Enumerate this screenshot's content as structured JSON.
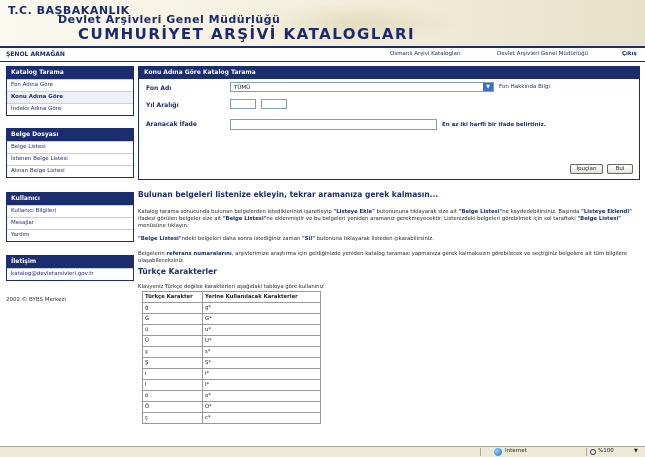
{
  "header": {
    "line1": "T.C. BAŞBAKANLIK",
    "line2": "Devlet Arşivleri Genel Müdürlüğü",
    "line3": "CUMHURİYET ARŞİVİ KATALOGLARI"
  },
  "topnav": {
    "user": "ŞENOL ARMAĞAN",
    "links": [
      "Osmanlı Arşivi Katalogları",
      "Devlet Arşivleri Genel Müdürlüğü",
      "Çıkış"
    ]
  },
  "sidebar": {
    "sections": [
      {
        "title": "Katalog Tarama",
        "items": [
          "Fon Adına Göre",
          "Konu Adına Göre",
          "İndeks Adına Göre"
        ]
      },
      {
        "title": "Belge Dosyası",
        "items": [
          "Belge Listesi",
          "İstenen Belge Listesi",
          "Alınan Belge Listesi"
        ]
      },
      {
        "title": "Kullanıcı",
        "items": [
          "Kullanıcı Bilgileri",
          "Mesajlar",
          "Yardım"
        ]
      },
      {
        "title": "İletişim",
        "items": [
          "katalog@devletarsivleri.gov.tr"
        ]
      }
    ],
    "copyright": "2002 © BYBS Merkezi"
  },
  "form": {
    "title": "Konu Adına Göre Katalog Tarama",
    "fon_label": "Fon Adı",
    "fon_value": "TÜMÜ",
    "fon_info": "Fon Hakkında Bilgi",
    "year_label": "Yıl Aralığı",
    "query_label": "Aranacak İfade",
    "query_hint": "En az iki harfli bir ifade belirtiniz.",
    "hint_button": "İpuçları",
    "find_button": "Bul"
  },
  "content": {
    "title": "Bulunan belgeleri listenize ekleyin, tekrar aramanıza gerek kalmasın...",
    "p1_a": "Katalog tarama sonucunda bulunan belgelerden istediklerinizi işaretleyip ",
    "p1_b": "\"Listeye Ekle\"",
    "p1_c": " butonununa tıklayarak size ait ",
    "p1_d": "\"Belge Listesi\"",
    "p1_e": "ne kaydedebilirsiniz. Başında ",
    "p1_f": "\"Listeye Eklendi\"",
    "p1_g": " ifadesi görülen belgeler size ait ",
    "p1_h": "\"Belge Listesi\"",
    "p1_i": "ne eklenmiştir ve bu belgeleri yeniden aramanız gerekmeyecektir. Listenizdeki belgeleri görebilmek için sol taraftaki ",
    "p1_j": "\"Belge Listesi\"",
    "p1_k": " menüsüne tıklayın.",
    "p2_a": "\"Belge Listesi\"",
    "p2_b": "ndeki belgeleri daha sonra istediğiniz zaman ",
    "p2_c": "\"Sil\"",
    "p2_d": " butonuna tıklayarak listeden çıkarabilirsiniz.",
    "p3_a": "Belgelerin ",
    "p3_b": "referans numaralarını",
    "p3_c": ", arşivlerimize araştırma için geldiğinizde yeniden katalog taraması yapmanıza gerek kalmaksızın görebilecek ve seçtiğiniz belgelere ait tüm bilgilere ulaşabileceksiniz."
  },
  "turkish": {
    "title": "Türkçe Karakterler",
    "intro": "Klavyeniz Türkçe değilse karakterleri aşağıdaki tabloya göre kullanınız",
    "headers": [
      "Türkçe Karakter",
      "Yerine Kullanılacak Karakterler"
    ],
    "rows": [
      [
        "ğ",
        "g*"
      ],
      [
        "Ğ",
        "G*"
      ],
      [
        "ü",
        "u*"
      ],
      [
        "Ü",
        "U*"
      ],
      [
        "ş",
        "s*"
      ],
      [
        "Ş",
        "S*"
      ],
      [
        "ı",
        "i*"
      ],
      [
        "İ",
        "I*"
      ],
      [
        "ö",
        "o*"
      ],
      [
        "Ö",
        "O*"
      ],
      [
        "ç",
        "c*"
      ]
    ]
  },
  "statusbar": {
    "zone": "Internet",
    "zoom": "%100"
  }
}
